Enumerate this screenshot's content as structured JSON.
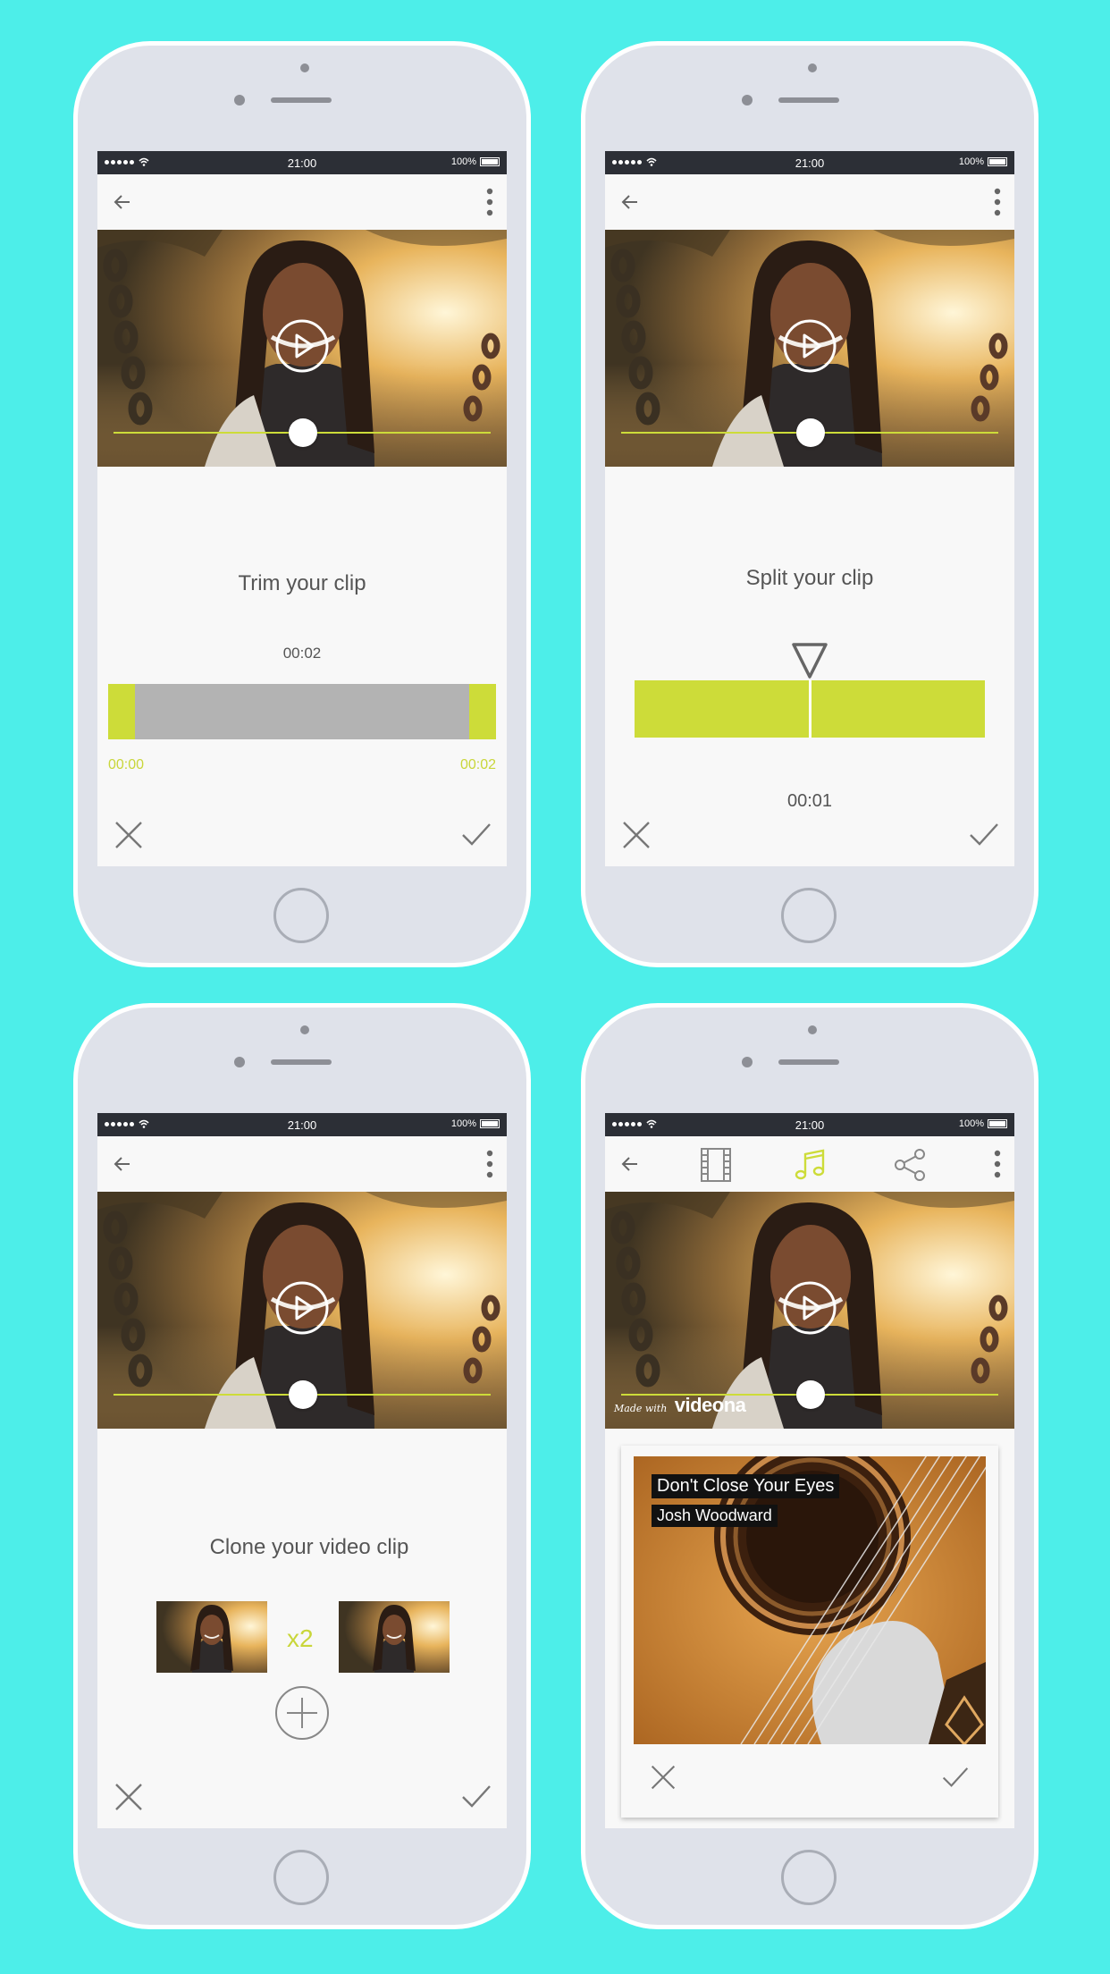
{
  "status_bar": {
    "time": "21:00",
    "battery": "100%"
  },
  "colors": {
    "accent": "#cddc39",
    "background": "#4deee9",
    "trim_gray": "#b3b3b3"
  },
  "icons": [
    "back-arrow-icon",
    "more-vert-icon",
    "play-icon",
    "close-icon",
    "check-icon",
    "add-circle-icon",
    "film-icon",
    "music-note-icon",
    "share-icon",
    "split-marker-icon"
  ],
  "trim": {
    "title": "Trim your clip",
    "duration": "00:02",
    "start_label": "00:00",
    "end_label": "00:02",
    "selection_start": 0.07,
    "selection_end": 0.93
  },
  "split": {
    "title": "Split your clip",
    "time": "00:01",
    "split_position": 0.5
  },
  "clone": {
    "title": "Clone your video clip",
    "multiplier": "x2"
  },
  "music": {
    "watermark_prefix": "Made with",
    "watermark_brand": "videona",
    "song_title": "Don't Close Your Eyes",
    "artist": "Josh Woodward"
  }
}
